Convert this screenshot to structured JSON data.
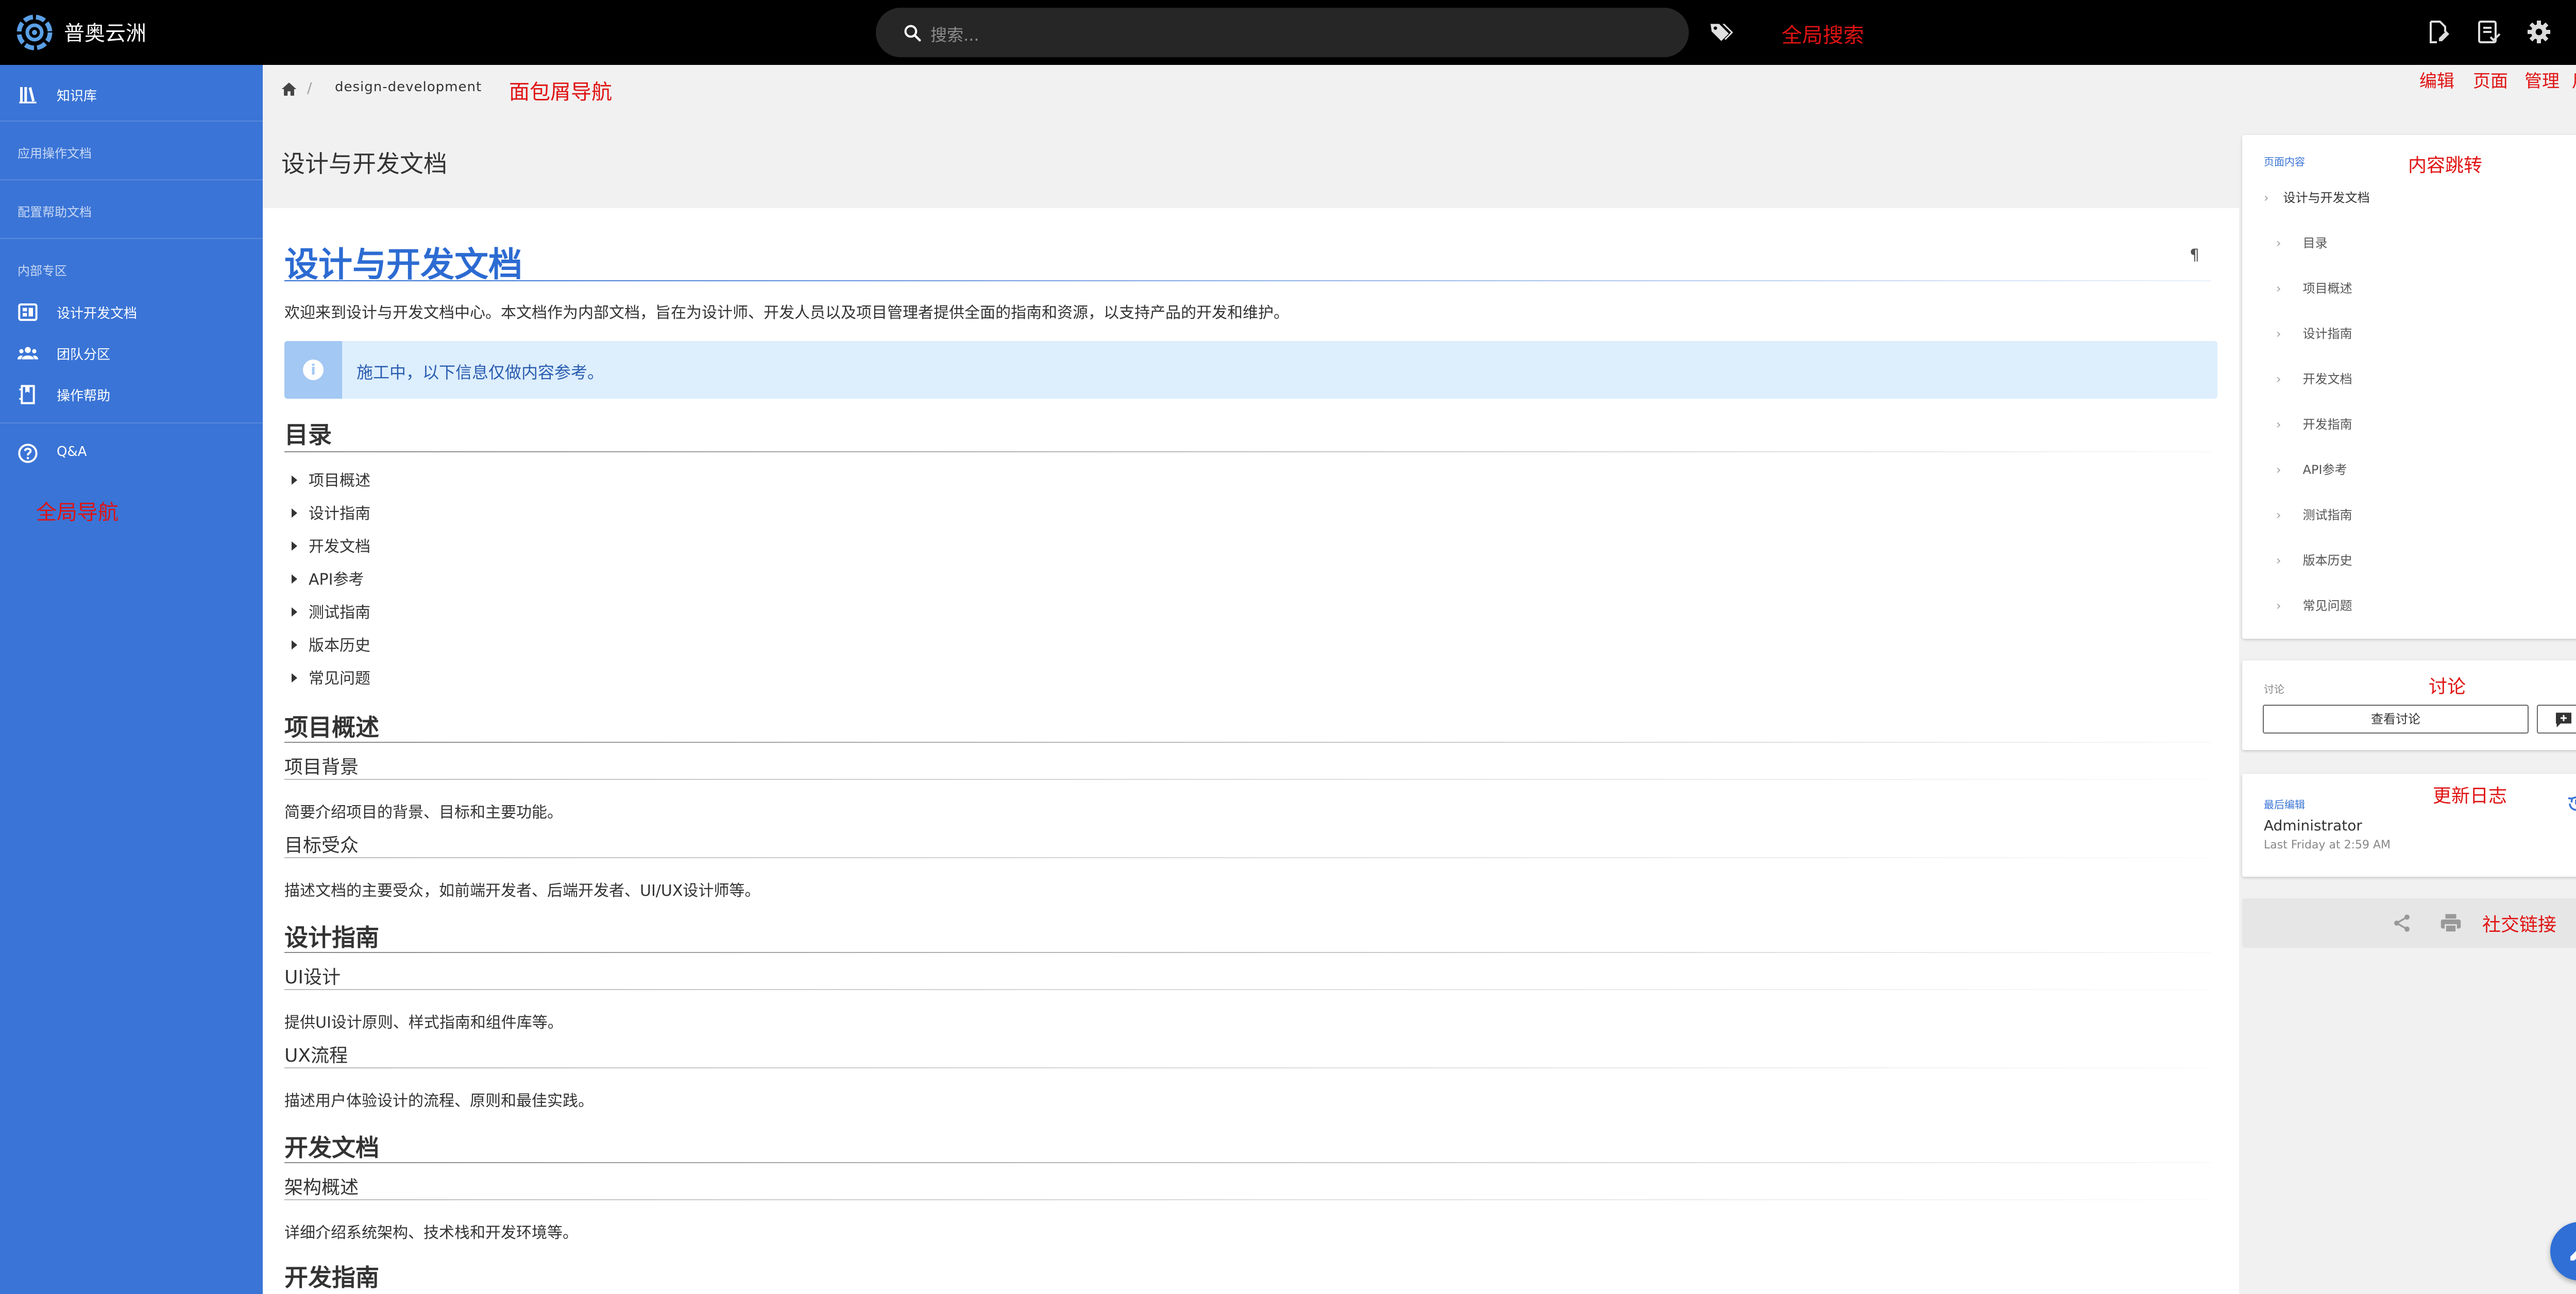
{
  "app": {
    "brand": "普奥云洲",
    "search_placeholder": "搜索..."
  },
  "annotations": {
    "global_search": "全局搜索",
    "breadcrumb": "面包屑导航",
    "edit": "编辑",
    "page": "页面",
    "admin": "管理",
    "user": "用户",
    "content_jump": "内容跳转",
    "discussion": "讨论",
    "update_log": "更新日志",
    "social_links": "社交链接",
    "global_nav": "全局导航"
  },
  "sidebar": {
    "items": [
      {
        "label": "知识库",
        "icon": "library-icon"
      },
      {
        "label": "应用操作文档"
      },
      {
        "label": "配置帮助文档"
      },
      {
        "label": "内部专区"
      },
      {
        "label": "设计开发文档",
        "icon": "dashboard-icon"
      },
      {
        "label": "团队分区",
        "icon": "team-icon"
      },
      {
        "label": "操作帮助",
        "icon": "book-icon"
      },
      {
        "label": "Q&A",
        "icon": "help-circle-icon"
      }
    ]
  },
  "breadcrumb": {
    "items": [
      "design-development"
    ]
  },
  "page": {
    "title": "设计与开发文档"
  },
  "article": {
    "title": "设计与开发文档",
    "intro": "欢迎来到设计与开发文档中心。本文档作为内部文档，旨在为设计师、开发人员以及项目管理者提供全面的指南和资源，以支持产品的开发和维护。",
    "callout": "施工中，以下信息仅做内容参考。",
    "toc_heading": "目录",
    "toc": [
      "项目概述",
      "设计指南",
      "开发文档",
      "API参考",
      "测试指南",
      "版本历史",
      "常见问题"
    ],
    "sections": [
      {
        "heading": "项目概述",
        "subsections": [
          {
            "heading": "项目背景",
            "text": "简要介绍项目的背景、目标和主要功能。"
          },
          {
            "heading": "目标受众",
            "text": "描述文档的主要受众，如前端开发者、后端开发者、UI/UX设计师等。"
          }
        ]
      },
      {
        "heading": "设计指南",
        "subsections": [
          {
            "heading": "UI设计",
            "text": "提供UI设计原则、样式指南和组件库等。"
          },
          {
            "heading": "UX流程",
            "text": "描述用户体验设计的流程、原则和最佳实践。"
          }
        ]
      },
      {
        "heading": "开发文档",
        "subsections": [
          {
            "heading": "架构概述",
            "text": "详细介绍系统架构、技术栈和开发环境等。"
          }
        ]
      },
      {
        "heading": "开发指南",
        "subsections": []
      }
    ]
  },
  "right_panel": {
    "toc_label": "页面内容",
    "toc_top": "设计与开发文档",
    "toc_items": [
      "目录",
      "项目概述",
      "设计指南",
      "开发文档",
      "开发指南",
      "API参考",
      "测试指南",
      "版本历史",
      "常见问题"
    ],
    "discussion_label": "讨论",
    "view_discussion": "查看讨论",
    "last_edit_label": "最后编辑",
    "last_edit_user": "Administrator",
    "last_edit_time": "Last Friday at 2:59 AM"
  },
  "colors": {
    "sidebar": "#3a74d6",
    "accent": "#2c6bd2",
    "annotation": "#e01313"
  }
}
